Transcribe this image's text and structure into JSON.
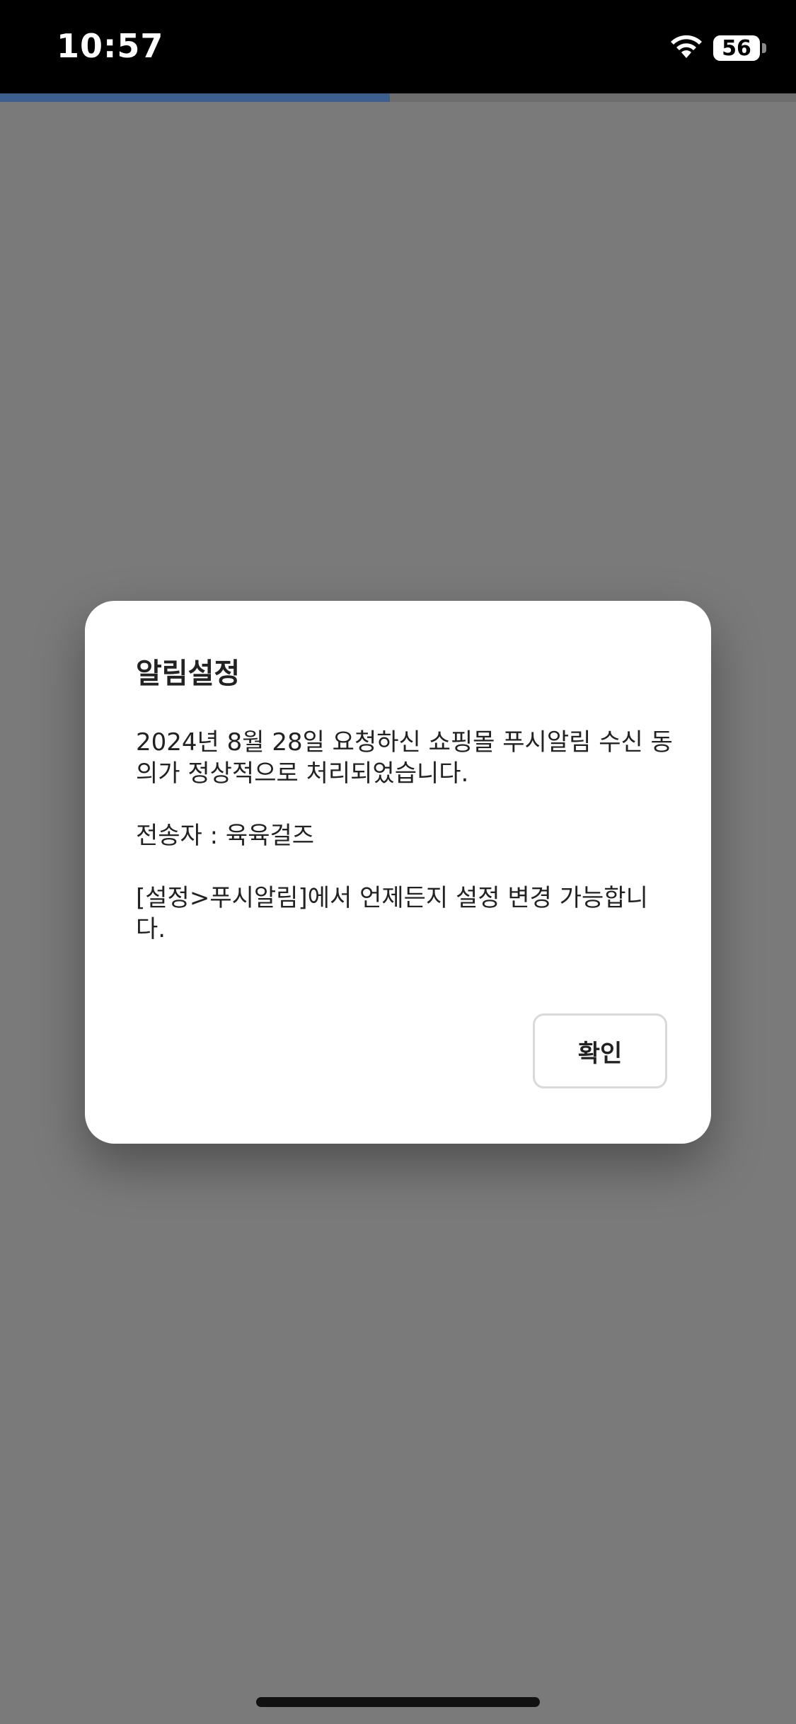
{
  "status_bar": {
    "time": "10:57",
    "battery_level": "56",
    "icons": [
      "wifi-icon",
      "battery-icon"
    ]
  },
  "loading_progress": 0.49,
  "colors": {
    "background_overlay": "#7a7a7a",
    "status_bar": "#000000",
    "progress_fill": "#3d5f8f",
    "dialog_background": "#ffffff"
  },
  "dialog": {
    "title": "알림설정",
    "message_line1": "2024년 8월 28일 요청하신 쇼핑몰 푸시알림 수신 동의가 정상적으로 처리되었습니다.",
    "sender": "전송자 : 육육걸즈",
    "message_line2": "[설정>푸시알림]에서 언제든지 설정 변경 가능합니다.",
    "confirm_label": "확인"
  }
}
